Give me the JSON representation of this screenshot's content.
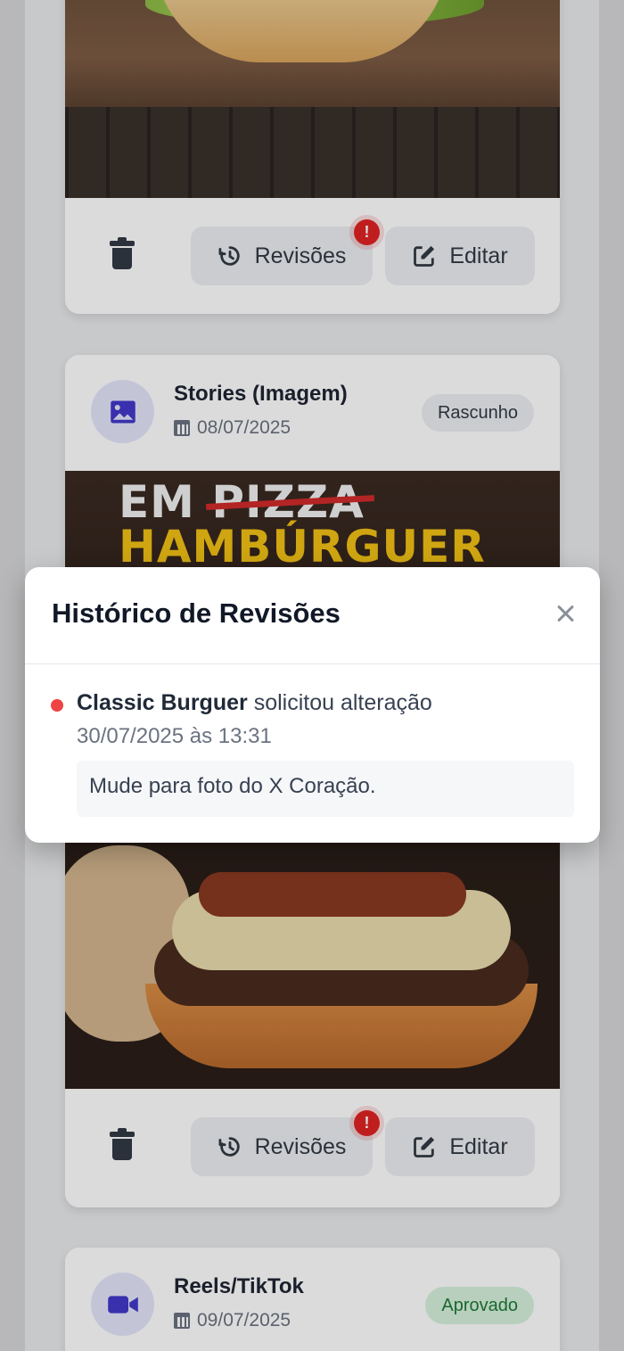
{
  "cards": [
    {
      "footer": {
        "revisions_label": "Revisões",
        "edit_label": "Editar",
        "revision_alert": "!"
      }
    },
    {
      "title": "Stories (Imagem)",
      "date": "08/07/2025",
      "status": "Rascunho",
      "image_text": {
        "line1_prefix": "EM",
        "line1_struck": "PIZZA",
        "line2": "HAMBÚRGUER"
      },
      "footer": {
        "revisions_label": "Revisões",
        "edit_label": "Editar",
        "revision_alert": "!"
      }
    },
    {
      "title": "Reels/TikTok",
      "date": "09/07/2025",
      "status": "Aprovado"
    }
  ],
  "modal": {
    "title": "Histórico de Revisões",
    "entries": [
      {
        "client": "Classic Burguer",
        "action": "solicitou alteração",
        "timestamp": "30/07/2025 às 13:31",
        "comment": "Mude para foto do X Coração."
      }
    ]
  },
  "colors": {
    "accent": "#4f46e5",
    "alert": "#e02424",
    "approved": "#1d7a36",
    "approved_bg": "#d7f2dd"
  },
  "icons": [
    "trash-icon",
    "history-icon",
    "edit-icon",
    "image-icon",
    "calendar-icon",
    "video-icon",
    "close-icon"
  ]
}
